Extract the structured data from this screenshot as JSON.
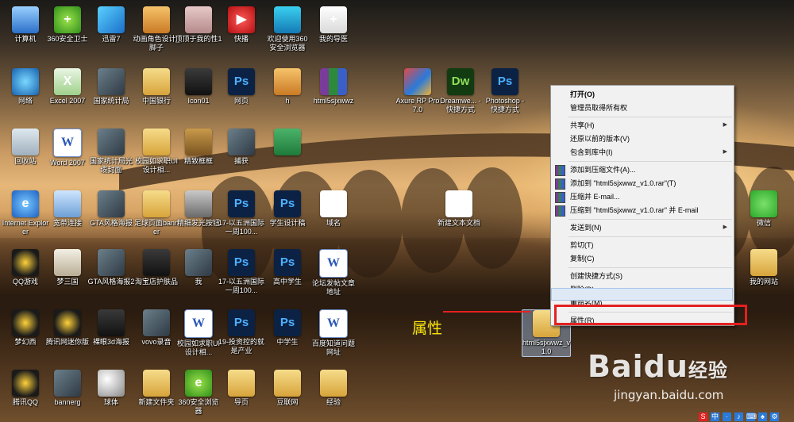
{
  "desktop": {
    "icons": [
      {
        "label": "计算机",
        "style": "pc",
        "text": ""
      },
      {
        "label": "360安全卫士",
        "style": "green",
        "text": "+"
      },
      {
        "label": "迅雷7",
        "style": "bird",
        "text": ""
      },
      {
        "label": "动画角色设计_脚子",
        "style": "orange",
        "text": ""
      },
      {
        "label": "顶顶于我的性1",
        "style": "pinkimg",
        "text": ""
      },
      {
        "label": "快播",
        "style": "red",
        "text": "▶"
      },
      {
        "label": "欢迎使用360安全浏览器",
        "style": "blue",
        "text": ""
      },
      {
        "label": "我的导医",
        "style": "doctor",
        "text": "+"
      },
      {
        "label": "网络",
        "style": "globe",
        "text": ""
      },
      {
        "label": "Excel 2007",
        "style": "excel",
        "text": "X"
      },
      {
        "label": "国家统计局",
        "style": "img",
        "text": ""
      },
      {
        "label": "中国银行",
        "style": "folder",
        "text": ""
      },
      {
        "label": "Icon01",
        "style": "dark",
        "text": ""
      },
      {
        "label": "网页",
        "style": "ps",
        "text": "Ps"
      },
      {
        "label": "h",
        "style": "orange",
        "text": ""
      },
      {
        "label": "html5sjxwwz",
        "style": "rar",
        "text": ""
      },
      {
        "label": "回收站",
        "style": "bin",
        "text": ""
      },
      {
        "label": "Word 2007",
        "style": "word",
        "text": "W"
      },
      {
        "label": "国家统计局光缆封面",
        "style": "img",
        "text": ""
      },
      {
        "label": "校园如求职UI设计相...",
        "style": "folder",
        "text": ""
      },
      {
        "label": "精致框框",
        "style": "frame",
        "text": ""
      },
      {
        "label": "捕获",
        "style": "img",
        "text": ""
      },
      {
        "label": "",
        "style": "greenbar",
        "text": ""
      },
      {
        "label": "Internet Explorer",
        "style": "ie",
        "text": "e"
      },
      {
        "label": "宽带连接",
        "style": "net",
        "text": ""
      },
      {
        "label": "GTA风格海报",
        "style": "img",
        "text": ""
      },
      {
        "label": "足球页面banner",
        "style": "folder",
        "text": ""
      },
      {
        "label": "精细发光按钮",
        "style": "btn",
        "text": ""
      },
      {
        "label": "17-以五洲国际一周100...",
        "style": "ps",
        "text": "Ps"
      },
      {
        "label": "学生设计稿",
        "style": "ps",
        "text": "Ps"
      },
      {
        "label": "域名",
        "style": "txt",
        "text": ""
      },
      {
        "label": "新建文本文档",
        "style": "txt",
        "text": ""
      },
      {
        "label": "QQ游戏",
        "style": "qq",
        "text": ""
      },
      {
        "label": "梦三国",
        "style": "panda",
        "text": ""
      },
      {
        "label": "GTA风格海报2",
        "style": "img",
        "text": ""
      },
      {
        "label": "淘宝店护肤品",
        "style": "dark",
        "text": ""
      },
      {
        "label": "我",
        "style": "img",
        "text": ""
      },
      {
        "label": "17-以五洲国际一周100...",
        "style": "ps",
        "text": "Ps"
      },
      {
        "label": "高中学生",
        "style": "ps",
        "text": "Ps"
      },
      {
        "label": "论坛发帖文章地址",
        "style": "word",
        "text": "W"
      },
      {
        "label": "梦幻西",
        "style": "qq",
        "text": ""
      },
      {
        "label": "腾讯网迷你版",
        "style": "qq",
        "text": ""
      },
      {
        "label": "裸眼3d海报",
        "style": "dark",
        "text": ""
      },
      {
        "label": "vovo录音",
        "style": "img",
        "text": ""
      },
      {
        "label": "校园如求职UI设计相...",
        "style": "word",
        "text": "W"
      },
      {
        "label": "19-投资控的就是产业",
        "style": "ps",
        "text": "Ps"
      },
      {
        "label": "中学生",
        "style": "ps",
        "text": "Ps"
      },
      {
        "label": "百度知道问题网址",
        "style": "word",
        "text": "W"
      },
      {
        "label": "腾讯QQ",
        "style": "qq",
        "text": ""
      },
      {
        "label": "bannerg",
        "style": "img",
        "text": ""
      },
      {
        "label": "球体",
        "style": "ball",
        "text": ""
      },
      {
        "label": "新建文件夹",
        "style": "folder",
        "text": ""
      },
      {
        "label": "360安全浏览器",
        "style": "green",
        "text": "e"
      },
      {
        "label": "导页",
        "style": "folder",
        "text": ""
      },
      {
        "label": "豆联网",
        "style": "folder",
        "text": ""
      },
      {
        "label": "经验",
        "style": "folder",
        "text": ""
      },
      {
        "label": "Axure RP Pro 7.0",
        "style": "axure",
        "text": ""
      },
      {
        "label": "Dreamwe... - 快捷方式",
        "style": "dw",
        "text": "Dw"
      },
      {
        "label": "Photoshop - 快捷方式",
        "style": "ps",
        "text": "Ps"
      },
      {
        "label": "微信",
        "style": "wechat",
        "text": ""
      },
      {
        "label": "我的网站",
        "style": "folder",
        "text": ""
      },
      {
        "label": "html5sjxwwz_v1.0",
        "style": "folder",
        "text": ""
      }
    ]
  },
  "context_menu": {
    "items": [
      {
        "label": "打开(O)",
        "bold": true,
        "submenu": false,
        "icon": false
      },
      {
        "label": "管理员取得所有权",
        "bold": false,
        "submenu": false,
        "icon": false
      },
      {
        "sep": true
      },
      {
        "label": "共享(H)",
        "bold": false,
        "submenu": true,
        "icon": false
      },
      {
        "label": "还原以前的版本(V)",
        "bold": false,
        "submenu": false,
        "icon": false
      },
      {
        "label": "包含到库中(I)",
        "bold": false,
        "submenu": true,
        "icon": false
      },
      {
        "sep": true
      },
      {
        "label": "添加到压缩文件(A)...",
        "bold": false,
        "submenu": false,
        "icon": true
      },
      {
        "label": "添加到 \"html5sjxwwz_v1.0.rar\"(T)",
        "bold": false,
        "submenu": false,
        "icon": true
      },
      {
        "label": "压缩并 E-mail...",
        "bold": false,
        "submenu": false,
        "icon": true
      },
      {
        "label": "压缩到 \"html5sjxwwz_v1.0.rar\" 并 E-mail",
        "bold": false,
        "submenu": false,
        "icon": true
      },
      {
        "sep": true
      },
      {
        "label": "发送到(N)",
        "bold": false,
        "submenu": true,
        "icon": false
      },
      {
        "sep": true
      },
      {
        "label": "剪切(T)",
        "bold": false,
        "submenu": false,
        "icon": false
      },
      {
        "label": "复制(C)",
        "bold": false,
        "submenu": false,
        "icon": false
      },
      {
        "sep": true
      },
      {
        "label": "创建快捷方式(S)",
        "bold": false,
        "submenu": false,
        "icon": false
      },
      {
        "label": "删除(D)",
        "bold": false,
        "submenu": false,
        "icon": false
      },
      {
        "label": "重命名(M)",
        "bold": false,
        "submenu": false,
        "icon": false
      },
      {
        "sep": true
      },
      {
        "label": "属性(R)",
        "bold": false,
        "submenu": false,
        "icon": false
      }
    ]
  },
  "annotation": {
    "label": "属性",
    "color": "#e52020",
    "text_color": "#ffe200"
  },
  "watermark": {
    "brand": "Bai",
    "brand_tail": "du",
    "product": "经验",
    "url": "jingyan.baidu.com"
  },
  "tray": {
    "items": [
      "S",
      "中",
      "·",
      "♪",
      "⌨",
      "♠",
      "⚙"
    ]
  }
}
